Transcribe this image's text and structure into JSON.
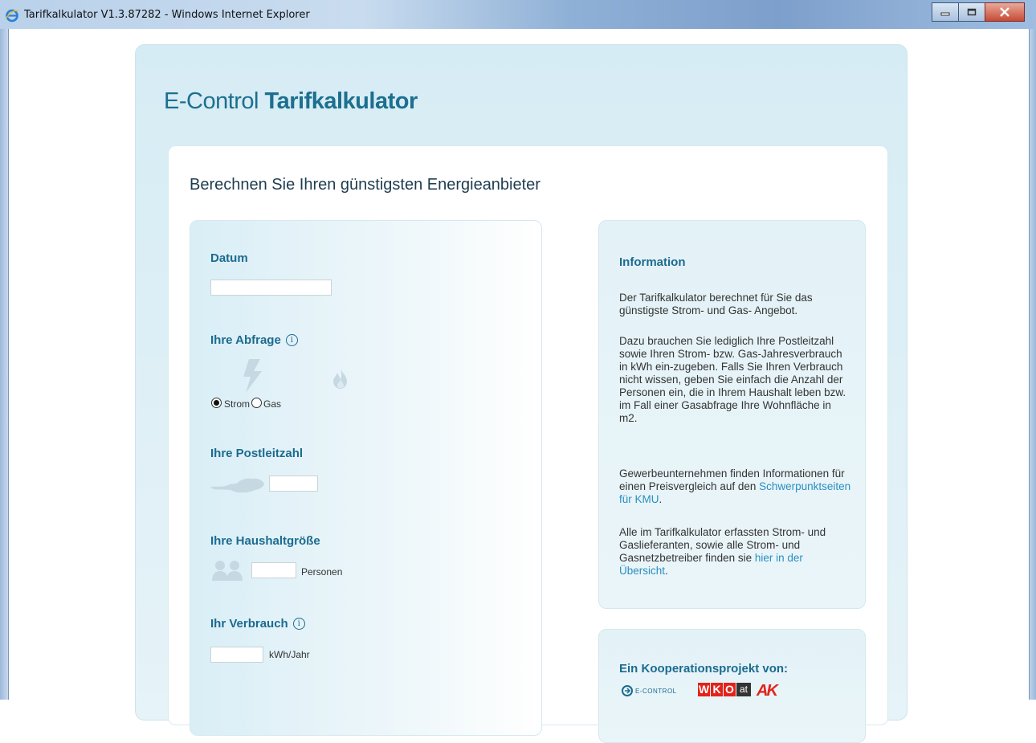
{
  "window": {
    "title": "Tarifkalkulator V1.3.87282 - Windows Internet Explorer"
  },
  "brand": {
    "light": "E-Control ",
    "bold": "Tarifkalkulator"
  },
  "page": {
    "heading": "Berechnen Sie Ihren günstigsten Energieanbieter"
  },
  "form": {
    "datum_label": "Datum",
    "datum_value": "",
    "abfrage_label": "Ihre Abfrage",
    "info_glyph": "i",
    "strom_label": "Strom",
    "gas_label": "Gas",
    "selected": "Strom",
    "plz_label": "Ihre Postleitzahl",
    "plz_value": "",
    "haushalt_label": "Ihre Haushaltgröße",
    "personen_value": "",
    "personen_unit": "Personen",
    "verbrauch_label": "Ihr Verbrauch",
    "verbrauch_value": "",
    "verbrauch_unit": "kWh/Jahr"
  },
  "info": {
    "title": "Information",
    "p1": "Der Tarifkalkulator berechnet für Sie das günstigste Strom- und Gas- Angebot.",
    "p2": "Dazu brauchen Sie lediglich Ihre Postleitzahl sowie Ihren Strom- bzw. Gas-Jahresverbrauch in kWh ein-zugeben. Falls Sie Ihren Verbrauch nicht wissen, geben Sie einfach die Anzahl der Personen ein, die in Ihrem Haushalt leben bzw. im Fall einer Gasabfrage Ihre Wohnfläche in m2.",
    "p3_text": "Gewerbeunternehmen finden Informationen für einen Preisvergleich auf den ",
    "p3_link": "Schwerpunktseiten für KMU",
    "p3_end": ".",
    "p4_text": "Alle im Tarifkalkulator erfassten Strom- und Gaslieferanten, sowie alle Strom- und Gasnetzbetreiber finden sie ",
    "p4_link": "hier in der Übersicht",
    "p4_end": "."
  },
  "coop": {
    "title": "Ein Kooperationsprojekt von:",
    "logo_econtrol": "E-CONTROL",
    "logo_wko_letters": [
      "W",
      "K",
      "O"
    ],
    "logo_wko_suffix": "at",
    "logo_ak": "AK"
  },
  "colors": {
    "accent": "#1c6b8f",
    "link": "#2a8fc0",
    "wko_red": "#e2231a"
  },
  "icons": {
    "lightning": "strom-lightning-icon",
    "flame": "gas-flame-icon",
    "austria_map": "austria-map-icon",
    "persons": "persons-icon",
    "info": "info-icon"
  }
}
